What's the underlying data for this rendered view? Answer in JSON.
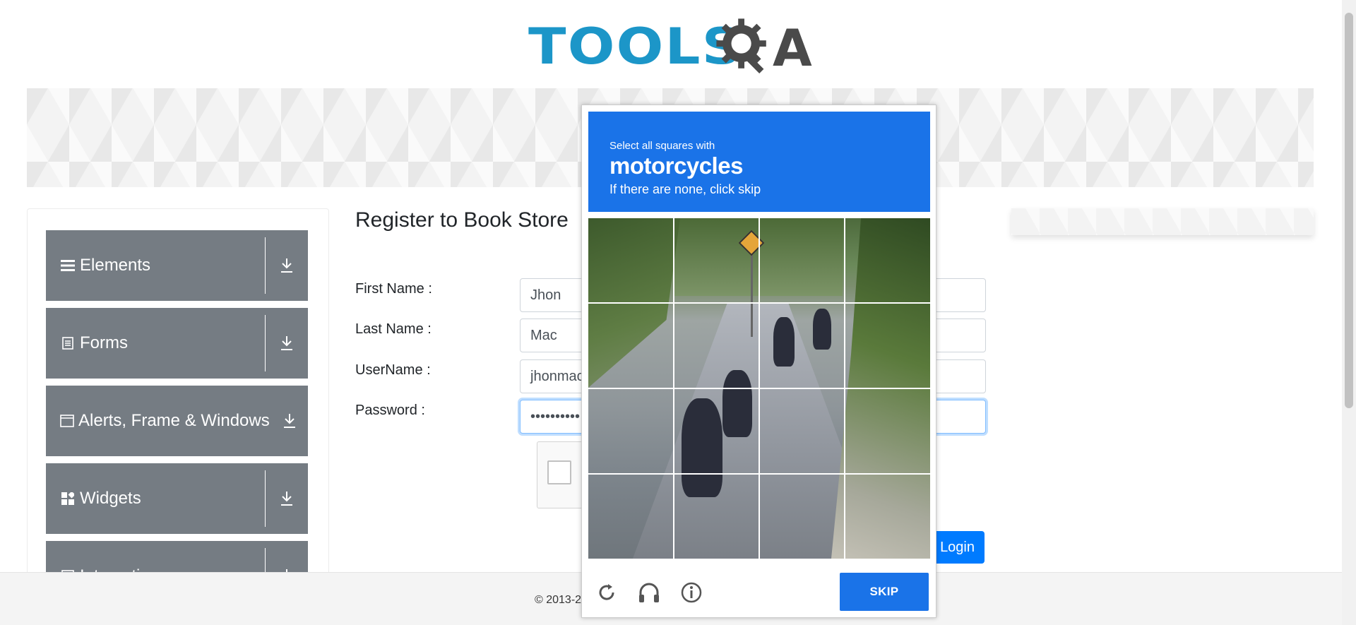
{
  "logo": {
    "text": "TOOLS",
    "suffix": "A"
  },
  "sidebar": {
    "items": [
      {
        "label": "Elements",
        "icon": "menu-icon"
      },
      {
        "label": "Forms",
        "icon": "form-icon"
      },
      {
        "label": "Alerts, Frame & Windows",
        "icon": "window-icon"
      },
      {
        "label": "Widgets",
        "icon": "widgets-icon"
      },
      {
        "label": "Interactions",
        "icon": "interactions-icon"
      }
    ]
  },
  "form": {
    "title": "Register to Book Store",
    "first_name_label": "First Name :",
    "first_name_value": "Jhon",
    "last_name_label": "Last Name :",
    "last_name_value": "Mac",
    "username_label": "UserName :",
    "username_value": "jhonmac",
    "password_label": "Password :",
    "password_value": "••••••••••",
    "login_label": "Login"
  },
  "footer": {
    "text": "© 2013-2"
  },
  "captcha": {
    "prompt": "Select all squares with",
    "target": "motorcycles",
    "subtext": "If there are none, click skip",
    "skip_label": "SKIP",
    "colors": {
      "header": "#1a73e8",
      "sidebar_group": "#757c83",
      "login": "#007bff"
    }
  }
}
